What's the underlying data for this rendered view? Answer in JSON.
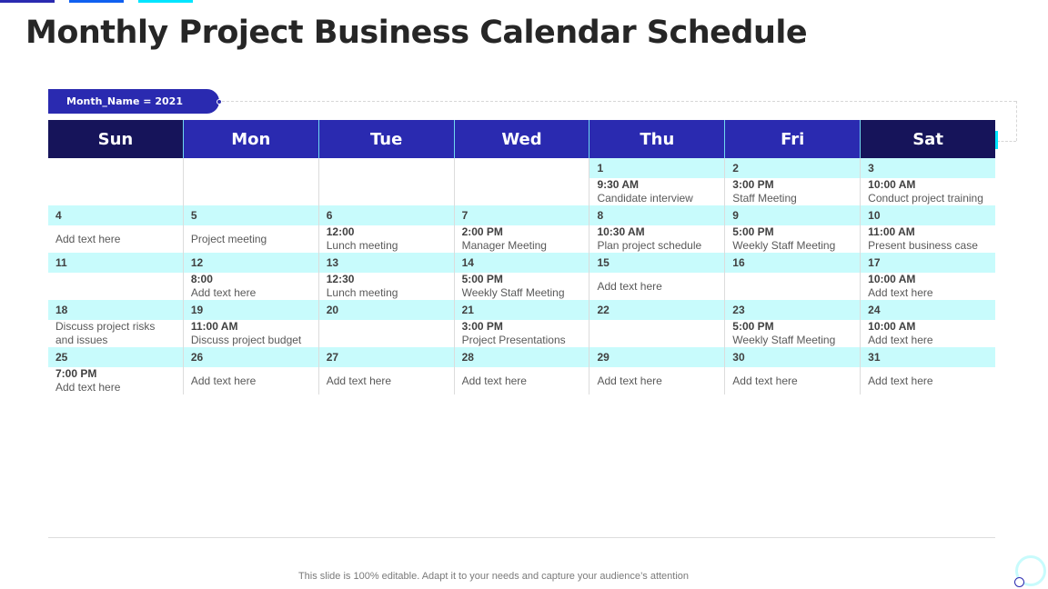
{
  "title": "Monthly Project Business Calendar Schedule",
  "month_tag": "Month_Name = 2021",
  "colors": {
    "primary": "#2a2ab0",
    "dark": "#16145a",
    "accent_cyan": "#00e5ff",
    "day_strip": "#c8fbfc",
    "secondary_blue": "#1060f0"
  },
  "weekdays": [
    "Sun",
    "Mon",
    "Tue",
    "Wed",
    "Thu",
    "Fri",
    "Sat"
  ],
  "weeks": [
    [
      {
        "day": "",
        "time": "",
        "text": ""
      },
      {
        "day": "",
        "time": "",
        "text": ""
      },
      {
        "day": "",
        "time": "",
        "text": ""
      },
      {
        "day": "",
        "time": "",
        "text": ""
      },
      {
        "day": "1",
        "time": "9:30 AM",
        "text": "Candidate  interview"
      },
      {
        "day": "2",
        "time": "3:00 PM",
        "text": "Staff Meeting"
      },
      {
        "day": "3",
        "time": "10:00 AM",
        "text": "Conduct  project training"
      }
    ],
    [
      {
        "day": "4",
        "time": "",
        "text": "Add text here"
      },
      {
        "day": "5",
        "time": "",
        "text": "Project meeting"
      },
      {
        "day": "6",
        "time": "12:00",
        "text": "Lunch  meeting"
      },
      {
        "day": "7",
        "time": "2:00 PM",
        "text": "Manager  Meeting"
      },
      {
        "day": "8",
        "time": "10:30 AM",
        "text": "Plan project  schedule"
      },
      {
        "day": "9",
        "time": "5:00 PM",
        "text": "Weekly Staff Meeting"
      },
      {
        "day": "10",
        "time": "11:00 AM",
        "text": "Present business case"
      }
    ],
    [
      {
        "day": "11",
        "time": "",
        "text": ""
      },
      {
        "day": "12",
        "time": "8:00",
        "text": "Add text here"
      },
      {
        "day": "13",
        "time": "12:30",
        "text": "Lunch  meeting"
      },
      {
        "day": "14",
        "time": "5:00 PM",
        "text": "Weekly Staff Meeting"
      },
      {
        "day": "15",
        "time": "",
        "text": "Add text here"
      },
      {
        "day": "16",
        "time": "",
        "text": ""
      },
      {
        "day": "17",
        "time": "10:00 AM",
        "text": "Add text here"
      }
    ],
    [
      {
        "day": "18",
        "time": "",
        "text": "Discuss project risks and issues"
      },
      {
        "day": "19",
        "time": "11:00 AM",
        "text": "Discuss project  budget"
      },
      {
        "day": "20",
        "time": "",
        "text": ""
      },
      {
        "day": "21",
        "time": "3:00 PM",
        "text": "Project Presentations"
      },
      {
        "day": "22",
        "time": "",
        "text": ""
      },
      {
        "day": "23",
        "time": "5:00 PM",
        "text": "Weekly Staff Meeting"
      },
      {
        "day": "24",
        "time": "10:00 AM",
        "text": "Add text here"
      }
    ],
    [
      {
        "day": "25",
        "time": "7:00 PM",
        "text": "Add text here"
      },
      {
        "day": "26",
        "time": "",
        "text": "Add text here"
      },
      {
        "day": "27",
        "time": "",
        "text": "Add text here"
      },
      {
        "day": "28",
        "time": "",
        "text": "Add text here"
      },
      {
        "day": "29",
        "time": "",
        "text": "Add text here"
      },
      {
        "day": "30",
        "time": "",
        "text": "Add text here"
      },
      {
        "day": "31",
        "time": "",
        "text": "Add text here"
      }
    ]
  ],
  "footer": "This slide is 100% editable. Adapt it to your needs and capture your audience’s attention"
}
